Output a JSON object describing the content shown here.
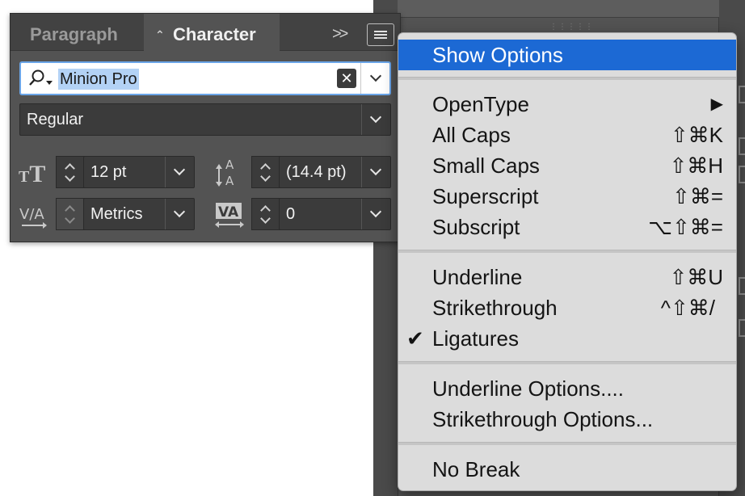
{
  "panel": {
    "tabs": [
      {
        "label": "Paragraph",
        "active": false
      },
      {
        "label": "Character",
        "active": true
      }
    ],
    "more_glyph": ">>",
    "font_family": {
      "value": "Minion Pro",
      "selected": true
    },
    "font_style": {
      "value": "Regular"
    },
    "font_size": {
      "value": "12 pt"
    },
    "leading": {
      "value": "(14.4 pt)"
    },
    "kerning": {
      "value": "Metrics"
    },
    "tracking": {
      "value": "0"
    }
  },
  "menu": {
    "items": [
      {
        "label": "Show Options",
        "shortcut": "",
        "highlighted": true
      },
      {
        "label": "OpenType",
        "shortcut": "▶",
        "submenu": true
      },
      {
        "label": "All Caps",
        "shortcut": "⇧⌘K"
      },
      {
        "label": "Small Caps",
        "shortcut": "⇧⌘H"
      },
      {
        "label": "Superscript",
        "shortcut": "⇧⌘="
      },
      {
        "label": "Subscript",
        "shortcut": "⌥⇧⌘="
      },
      {
        "label": "Underline",
        "shortcut": "⇧⌘U"
      },
      {
        "label": "Strikethrough",
        "shortcut": "^⇧⌘/"
      },
      {
        "label": "Ligatures",
        "shortcut": "",
        "checked": true,
        "check_glyph": "✔"
      },
      {
        "label": "Underline Options....",
        "shortcut": ""
      },
      {
        "label": "Strikethrough Options...",
        "shortcut": ""
      },
      {
        "label": "No Break",
        "shortcut": ""
      }
    ]
  },
  "colors": {
    "panel_bg": "#535353",
    "field_bg": "#3b3b3b",
    "menu_bg": "#dcdcdc",
    "menu_highlight": "#1c69d4",
    "selection": "#b3d2f5",
    "focus_ring": "#6aa5e8"
  }
}
